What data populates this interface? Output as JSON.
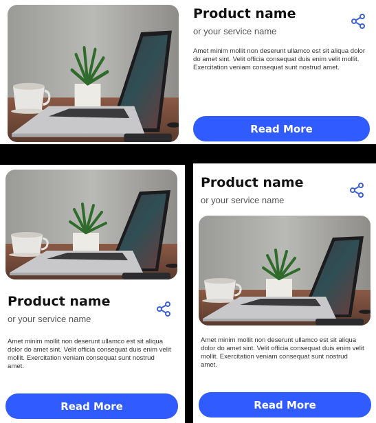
{
  "cards": [
    {
      "title": "Product name",
      "subtitle": "or your service name",
      "description": "Amet minim mollit non deserunt ullamco est sit aliqua dolor do amet sint. Velit officia consequat duis enim velit mollit. Exercitation veniam consequat sunt nostrud amet.",
      "button_label": "Read More",
      "share_icon": "share-icon",
      "image": "laptop-desk-photo"
    },
    {
      "title": "Product name",
      "subtitle": "or your service name",
      "description": "Amet minim mollit non deserunt ullamco est sit aliqua dolor do amet sint. Velit officia consequat duis enim velit mollit. Exercitation veniam consequat sunt nostrud amet.",
      "button_label": "Read More",
      "share_icon": "share-icon",
      "image": "laptop-desk-photo"
    },
    {
      "title": "Product name",
      "subtitle": "or your service name",
      "description": "Amet minim mollit non deserunt ullamco est sit aliqua dolor do amet sint. Velit officia consequat duis enim velit mollit. Exercitation veniam consequat sunt nostrud amet.",
      "button_label": "Read More",
      "share_icon": "share-icon",
      "image": "laptop-desk-photo"
    }
  ],
  "colors": {
    "accent": "#2f5bff",
    "share_icon": "#3d5fd9",
    "background": "#000000"
  }
}
